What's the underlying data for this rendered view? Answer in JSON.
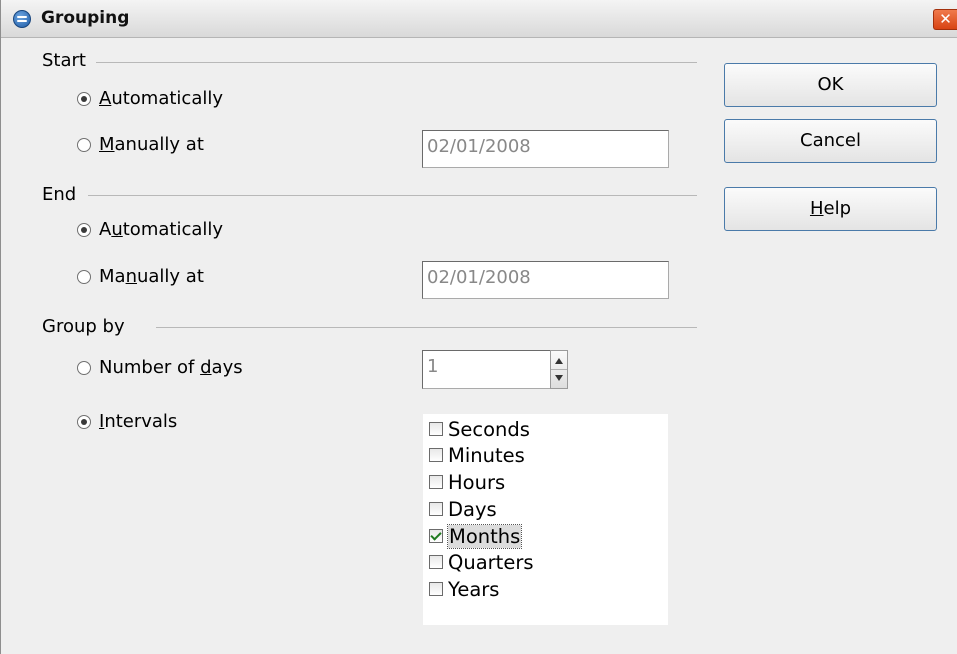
{
  "window": {
    "title": "Grouping",
    "close_label": "✕"
  },
  "start": {
    "label": "Start",
    "auto_label": "Automatically",
    "manual_label": "Manually at",
    "selected": "automatically",
    "date": "02/01/2008"
  },
  "end": {
    "label": "End",
    "auto_label": "Automatically",
    "manual_label": "Manually at",
    "selected": "automatically",
    "date": "02/01/2008"
  },
  "group_by": {
    "label": "Group by",
    "days_label": "Number of days",
    "days_value": "1",
    "intervals_label": "Intervals",
    "selected": "intervals",
    "intervals": [
      {
        "label": "Seconds",
        "checked": false
      },
      {
        "label": "Minutes",
        "checked": false
      },
      {
        "label": "Hours",
        "checked": false
      },
      {
        "label": "Days",
        "checked": false
      },
      {
        "label": "Months",
        "checked": true
      },
      {
        "label": "Quarters",
        "checked": false
      },
      {
        "label": "Years",
        "checked": false
      }
    ]
  },
  "buttons": {
    "ok": "OK",
    "cancel": "Cancel",
    "help": "Help"
  }
}
